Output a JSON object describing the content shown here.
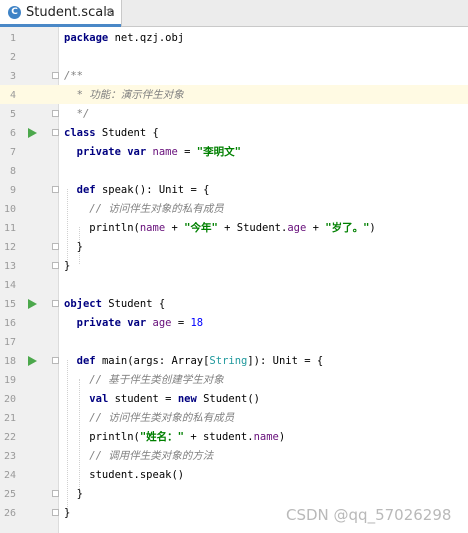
{
  "tab": {
    "icon_letter": "C",
    "label": "Student.scala",
    "close": "✕"
  },
  "watermark": "CSDN @qq_57026298",
  "lines": [
    {
      "n": "1",
      "parts": [
        [
          "kw",
          "package"
        ],
        [
          "p",
          " net.qzj.obj"
        ]
      ]
    },
    {
      "n": "2",
      "parts": []
    },
    {
      "n": "3",
      "fold": true,
      "parts": [
        [
          "cm",
          "/**"
        ]
      ]
    },
    {
      "n": "4",
      "parts": [
        [
          "cm",
          "  * 功能：演示伴生对象"
        ]
      ]
    },
    {
      "n": "5",
      "fold": true,
      "parts": [
        [
          "cm",
          "  */"
        ]
      ]
    },
    {
      "n": "6",
      "run": true,
      "fold": true,
      "parts": [
        [
          "kw",
          "class"
        ],
        [
          "p",
          " Student {"
        ]
      ]
    },
    {
      "n": "7",
      "parts": [
        [
          "p",
          "  "
        ],
        [
          "kw",
          "private var"
        ],
        [
          "p",
          " "
        ],
        [
          "fd",
          "name"
        ],
        [
          "p",
          " = "
        ],
        [
          "st",
          "\"李明文\""
        ]
      ]
    },
    {
      "n": "8",
      "parts": []
    },
    {
      "n": "9",
      "fold": true,
      "parts": [
        [
          "p",
          "  "
        ],
        [
          "kw",
          "def"
        ],
        [
          "p",
          " speak(): Unit = {"
        ]
      ]
    },
    {
      "n": "10",
      "parts": [
        [
          "p",
          "    "
        ],
        [
          "cm",
          "// 访问伴生对象的私有成员"
        ]
      ]
    },
    {
      "n": "11",
      "parts": [
        [
          "p",
          "    println("
        ],
        [
          "fd",
          "name"
        ],
        [
          "p",
          " + "
        ],
        [
          "st",
          "\"今年\""
        ],
        [
          "p",
          " + Student."
        ],
        [
          "fd",
          "age"
        ],
        [
          "p",
          " + "
        ],
        [
          "st",
          "\"岁了。\""
        ],
        [
          "p",
          ")"
        ]
      ]
    },
    {
      "n": "12",
      "fold": true,
      "parts": [
        [
          "p",
          "  }"
        ]
      ]
    },
    {
      "n": "13",
      "fold": true,
      "parts": [
        [
          "p",
          "}"
        ]
      ]
    },
    {
      "n": "14",
      "parts": []
    },
    {
      "n": "15",
      "run": true,
      "fold": true,
      "parts": [
        [
          "kw",
          "object"
        ],
        [
          "p",
          " Student {"
        ]
      ]
    },
    {
      "n": "16",
      "parts": [
        [
          "p",
          "  "
        ],
        [
          "kw",
          "private var"
        ],
        [
          "p",
          " "
        ],
        [
          "fd",
          "age"
        ],
        [
          "p",
          " = "
        ],
        [
          "nm",
          "18"
        ]
      ]
    },
    {
      "n": "17",
      "parts": []
    },
    {
      "n": "18",
      "run": true,
      "fold": true,
      "parts": [
        [
          "p",
          "  "
        ],
        [
          "kw",
          "def"
        ],
        [
          "p",
          " main(args: Array["
        ],
        [
          "tp",
          "String"
        ],
        [
          "p",
          "]): Unit = {"
        ]
      ]
    },
    {
      "n": "19",
      "parts": [
        [
          "p",
          "    "
        ],
        [
          "cm",
          "// 基于伴生类创建学生对象"
        ]
      ]
    },
    {
      "n": "20",
      "parts": [
        [
          "p",
          "    "
        ],
        [
          "kw",
          "val"
        ],
        [
          "p",
          " student = "
        ],
        [
          "kw",
          "new"
        ],
        [
          "p",
          " Student()"
        ]
      ]
    },
    {
      "n": "21",
      "parts": [
        [
          "p",
          "    "
        ],
        [
          "cm",
          "// 访问伴生类对象的私有成员"
        ]
      ]
    },
    {
      "n": "22",
      "parts": [
        [
          "p",
          "    println("
        ],
        [
          "st",
          "\"姓名：\""
        ],
        [
          "p",
          " + student."
        ],
        [
          "fd",
          "name"
        ],
        [
          "p",
          ")"
        ]
      ]
    },
    {
      "n": "23",
      "parts": [
        [
          "p",
          "    "
        ],
        [
          "cm",
          "// 调用伴生类对象的方法"
        ]
      ]
    },
    {
      "n": "24",
      "parts": [
        [
          "p",
          "    student.speak()"
        ]
      ]
    },
    {
      "n": "25",
      "fold": true,
      "parts": [
        [
          "p",
          "  }"
        ]
      ]
    },
    {
      "n": "26",
      "fold": true,
      "parts": [
        [
          "p",
          "}"
        ]
      ]
    }
  ]
}
